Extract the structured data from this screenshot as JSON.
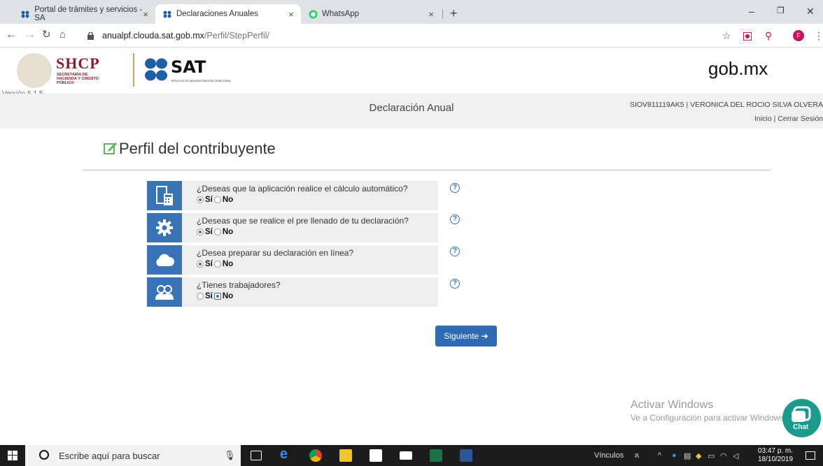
{
  "browser": {
    "tabs": [
      {
        "title": "Portal de trámites y servicios - SA"
      },
      {
        "title": "Declaraciones Anuales"
      },
      {
        "title": "WhatsApp"
      }
    ],
    "url_host": "anualpf.clouda.sat.gob.mx",
    "url_path": "/Perfil/StepPerfil/",
    "profile_initial": "F"
  },
  "header": {
    "shcp": "SHCP",
    "shcp_sub": "SECRETARÍA DE HACIENDA Y CRÉDITO PÚBLICO",
    "sat": "SAT",
    "sat_sub": "SERVICIO DE ADMINISTRACIÓN TRIBUTARIA",
    "gobmx": "gob.mx",
    "version": "Versión 5.1.5"
  },
  "bar": {
    "title": "Declaración Anual",
    "user": "SIOV811119AK5 | VERONICA DEL ROCIO SILVA OLVERA",
    "inicio": "Inicio",
    "pipe": " | ",
    "cerrar": "Cerrar Sesión"
  },
  "page": {
    "title": "Perfil del contribuyente",
    "questions": [
      {
        "text": "¿Deseas que la aplicación realice el cálculo automático?",
        "yes": "Sí",
        "no": "No",
        "selected": "Sí"
      },
      {
        "text": "¿Deseas que se realice el pre llenado de tu declaración?",
        "yes": "Sí",
        "no": "No",
        "selected": "Sí"
      },
      {
        "text": "¿Desea preparar su declaración en línea?",
        "yes": "Sí",
        "no": "No",
        "selected": "Sí"
      },
      {
        "text": "¿Tienes trabajadores?",
        "yes": "Sí",
        "no": "No",
        "selected": "No"
      }
    ],
    "next_label": "Siguiente"
  },
  "watermark": {
    "line1": "Activar Windows",
    "line2": "Ve a Configuración para activar Windows."
  },
  "chat_label": "Chat",
  "taskbar": {
    "search_placeholder": "Escribe aquí para buscar",
    "vinculos": "Vínculos",
    "time": "03:47 p. m.",
    "date": "18/10/2019"
  },
  "colors": {
    "primary": "#3a73b5",
    "button": "#2f6ab2",
    "shcp": "#8b1c30",
    "chat": "#1a9a8c"
  }
}
